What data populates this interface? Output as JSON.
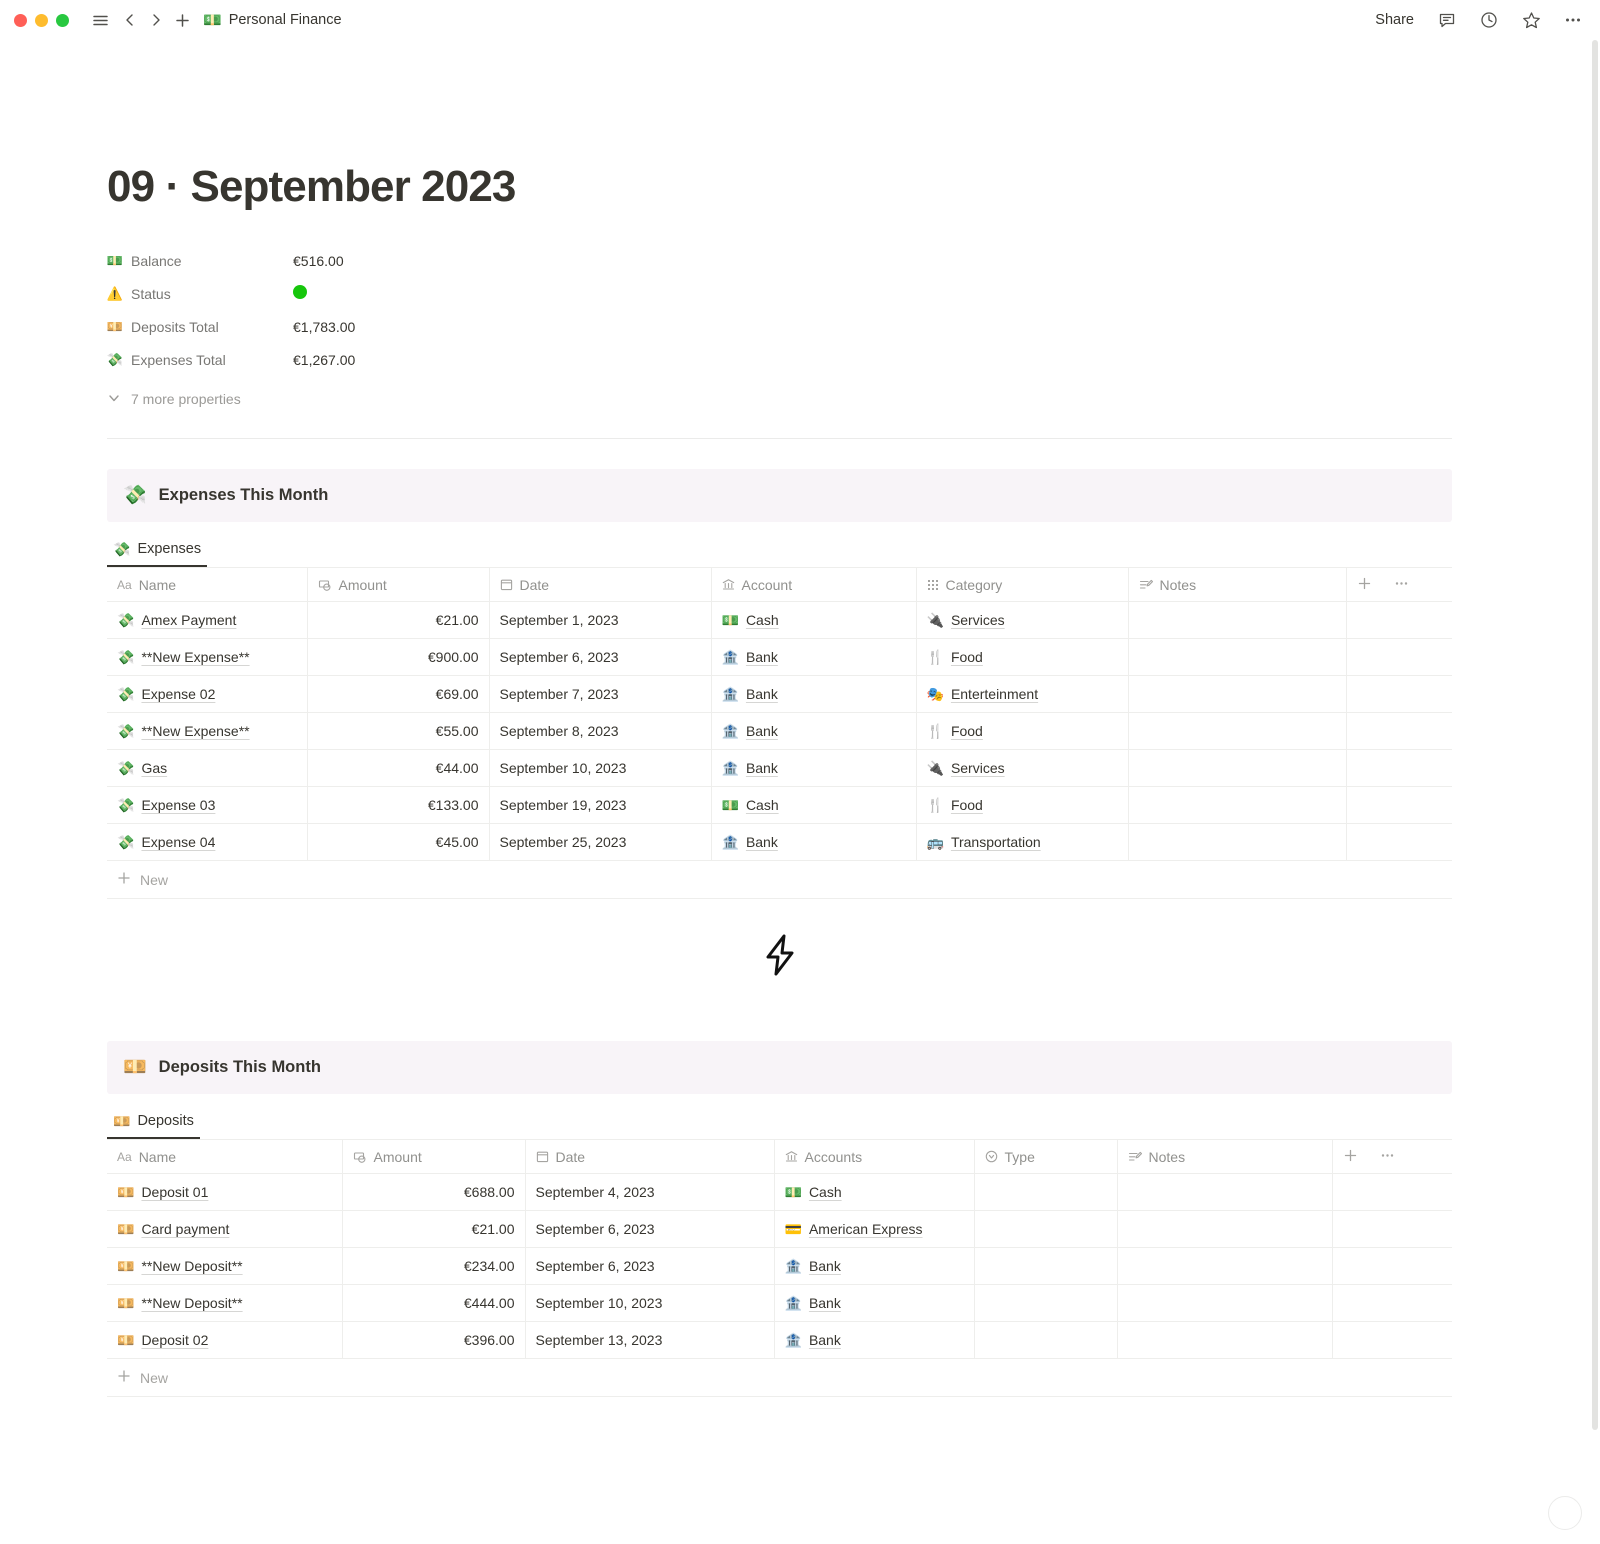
{
  "window": {
    "traffic_lights": [
      "close",
      "minimize",
      "maximize"
    ],
    "breadcrumb_emoji": "💵",
    "breadcrumb_title": "Personal Finance",
    "share_label": "Share"
  },
  "page": {
    "title": "09 · September 2023"
  },
  "properties": [
    {
      "icon": "💵",
      "label": "Balance",
      "value": "€516.00",
      "type": "text"
    },
    {
      "icon": "⚠️",
      "label": "Status",
      "value": "",
      "type": "status",
      "color": "#16c60c"
    },
    {
      "icon": "💴",
      "label": "Deposits Total",
      "value": "€1,783.00",
      "type": "text"
    },
    {
      "icon": "💸",
      "label": "Expenses Total",
      "value": "€1,267.00",
      "type": "text"
    }
  ],
  "more_properties_label": "7 more properties",
  "expenses_section": {
    "callout_emoji": "💸",
    "callout_title": "Expenses This Month",
    "tab_emoji": "💸",
    "tab_label": "Expenses",
    "columns": [
      {
        "label": "Name",
        "icon": "title-icon"
      },
      {
        "label": "Amount",
        "icon": "money-icon"
      },
      {
        "label": "Date",
        "icon": "calendar-icon"
      },
      {
        "label": "Account",
        "icon": "bank-icon"
      },
      {
        "label": "Category",
        "icon": "grid-icon"
      },
      {
        "label": "Notes",
        "icon": "notes-icon"
      }
    ],
    "rows": [
      {
        "emoji": "💸",
        "name": "Amex Payment",
        "amount": "€21.00",
        "date": "September 1, 2023",
        "account_emoji": "💵",
        "account": "Cash",
        "category_emoji": "🔌",
        "category": "Services",
        "notes": ""
      },
      {
        "emoji": "💸",
        "name": "**New Expense**",
        "amount": "€900.00",
        "date": "September 6, 2023",
        "account_emoji": "🏦",
        "account": "Bank",
        "category_emoji": "🍴",
        "category": "Food",
        "notes": ""
      },
      {
        "emoji": "💸",
        "name": "Expense 02",
        "amount": "€69.00",
        "date": "September 7, 2023",
        "account_emoji": "🏦",
        "account": "Bank",
        "category_emoji": "🎭",
        "category": "Enterteinment",
        "notes": ""
      },
      {
        "emoji": "💸",
        "name": "**New Expense**",
        "amount": "€55.00",
        "date": "September 8, 2023",
        "account_emoji": "🏦",
        "account": "Bank",
        "category_emoji": "🍴",
        "category": "Food",
        "notes": ""
      },
      {
        "emoji": "💸",
        "name": "Gas",
        "amount": "€44.00",
        "date": "September 10, 2023",
        "account_emoji": "🏦",
        "account": "Bank",
        "category_emoji": "🔌",
        "category": "Services",
        "notes": ""
      },
      {
        "emoji": "💸",
        "name": "Expense 03",
        "amount": "€133.00",
        "date": "September 19, 2023",
        "account_emoji": "💵",
        "account": "Cash",
        "category_emoji": "🍴",
        "category": "Food",
        "notes": ""
      },
      {
        "emoji": "💸",
        "name": "Expense 04",
        "amount": "€45.00",
        "date": "September 25, 2023",
        "account_emoji": "🏦",
        "account": "Bank",
        "category_emoji": "🚌",
        "category": "Transportation",
        "notes": ""
      }
    ],
    "new_label": "New"
  },
  "divider_glyph": "lightning-bolt",
  "deposits_section": {
    "callout_emoji": "💴",
    "callout_title": "Deposits This Month",
    "tab_emoji": "💴",
    "tab_label": "Deposits",
    "columns": [
      {
        "label": "Name",
        "icon": "title-icon"
      },
      {
        "label": "Amount",
        "icon": "money-icon"
      },
      {
        "label": "Date",
        "icon": "calendar-icon"
      },
      {
        "label": "Accounts",
        "icon": "bank-icon"
      },
      {
        "label": "Type",
        "icon": "select-icon"
      },
      {
        "label": "Notes",
        "icon": "notes-icon"
      }
    ],
    "rows": [
      {
        "emoji": "💴",
        "name": "Deposit 01",
        "amount": "€688.00",
        "date": "September 4, 2023",
        "account_emoji": "💵",
        "account": "Cash",
        "type": "",
        "notes": ""
      },
      {
        "emoji": "💴",
        "name": "Card payment",
        "amount": "€21.00",
        "date": "September 6, 2023",
        "account_emoji": "💳",
        "account": "American Express",
        "type": "",
        "notes": ""
      },
      {
        "emoji": "💴",
        "name": "**New Deposit**",
        "amount": "€234.00",
        "date": "September 6, 2023",
        "account_emoji": "🏦",
        "account": "Bank",
        "type": "",
        "notes": ""
      },
      {
        "emoji": "💴",
        "name": "**New Deposit**",
        "amount": "€444.00",
        "date": "September 10, 2023",
        "account_emoji": "🏦",
        "account": "Bank",
        "type": "",
        "notes": ""
      },
      {
        "emoji": "💴",
        "name": "Deposit 02",
        "amount": "€396.00",
        "date": "September 13, 2023",
        "account_emoji": "🏦",
        "account": "Bank",
        "type": "",
        "notes": ""
      }
    ],
    "new_label": "New"
  },
  "colors": {
    "callout_bg": "#f8f4f8",
    "status_green": "#16c60c",
    "text": "#37352f",
    "muted": "#91918e"
  }
}
